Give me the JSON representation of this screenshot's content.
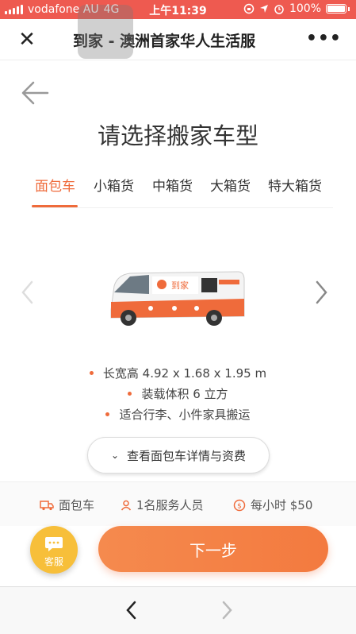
{
  "status_bar": {
    "carrier": "vodafone AU",
    "network": "4G",
    "time": "上午11:39",
    "battery": "100%"
  },
  "nav": {
    "title": "到家 - 澳洲首家华人生活服"
  },
  "page": {
    "title": "请选择搬家车型"
  },
  "tabs": [
    {
      "label": "面包车",
      "active": true
    },
    {
      "label": "小箱货",
      "active": false
    },
    {
      "label": "中箱货",
      "active": false
    },
    {
      "label": "大箱货",
      "active": false
    },
    {
      "label": "特大箱货",
      "active": false
    }
  ],
  "vehicle": {
    "brand_label": "到家"
  },
  "specs": [
    "长宽高 4.92 x 1.68 x 1.95 m",
    "装载体积 6 立方",
    "适合行李、小件家具搬运"
  ],
  "detail_button": {
    "label": "查看面包车详情与资费"
  },
  "summary": {
    "vehicle": "面包车",
    "staff": "1名服务人员",
    "rate": "每小时 $50"
  },
  "service_button": {
    "label": "客服"
  },
  "next_button": {
    "label": "下一步"
  },
  "colors": {
    "accent": "#ef6b3b",
    "status_bar": "#ee5a50",
    "service": "#f7bf3a"
  }
}
